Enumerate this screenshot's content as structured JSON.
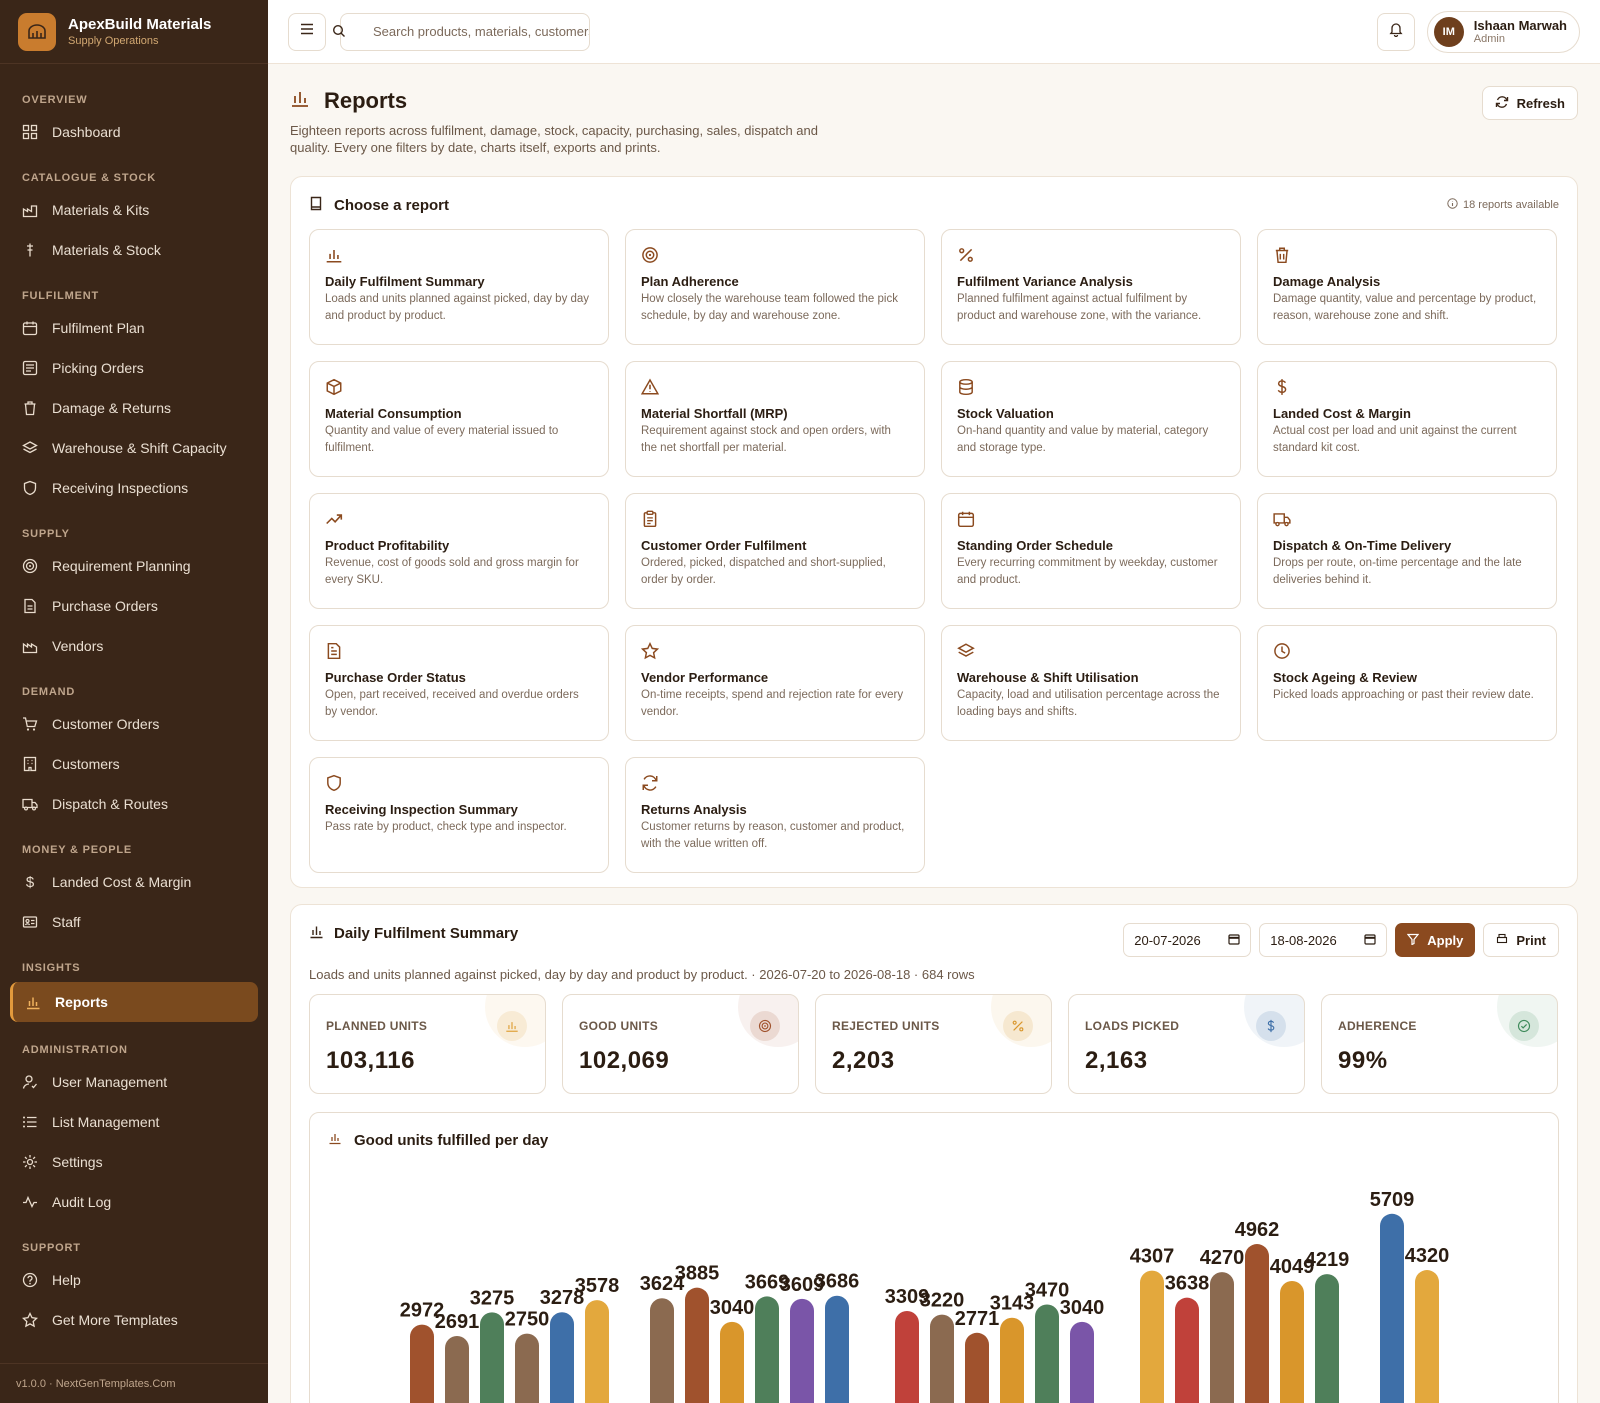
{
  "brand": {
    "name": "ApexBuild Materials",
    "subtitle": "Supply Operations"
  },
  "sidebar": {
    "sections": {
      "overview": "OVERVIEW",
      "catalogue": "CATALOGUE & STOCK",
      "fulfilment": "FULFILMENT",
      "supply": "SUPPLY",
      "demand": "DEMAND",
      "money": "MONEY & PEOPLE",
      "insights": "INSIGHTS",
      "administration": "ADMINISTRATION",
      "support": "SUPPORT"
    },
    "items": {
      "dashboard": "Dashboard",
      "materials_kits": "Materials & Kits",
      "materials_stock": "Materials & Stock",
      "fulfilment_plan": "Fulfilment Plan",
      "picking_orders": "Picking Orders",
      "damage_returns": "Damage & Returns",
      "warehouse_capacity": "Warehouse & Shift Capacity",
      "receiving_inspections": "Receiving Inspections",
      "requirement_planning": "Requirement Planning",
      "purchase_orders": "Purchase Orders",
      "vendors": "Vendors",
      "customer_orders": "Customer Orders",
      "customers": "Customers",
      "dispatch_routes": "Dispatch & Routes",
      "landed_cost": "Landed Cost & Margin",
      "staff": "Staff",
      "reports": "Reports",
      "user_management": "User Management",
      "list_management": "List Management",
      "settings": "Settings",
      "audit_log": "Audit Log",
      "help": "Help",
      "get_templates": "Get More Templates"
    },
    "footer": "v1.0.0 · NextGenTemplates.Com"
  },
  "topbar": {
    "search_placeholder": "Search products, materials, customers",
    "user_initials": "IM",
    "user_name": "Ishaan Marwah",
    "user_role": "Admin"
  },
  "page": {
    "title": "Reports",
    "description": "Eighteen reports across fulfilment, damage, stock, capacity, purchasing, sales, dispatch and quality. Every one filters by date, charts itself, exports and prints.",
    "refresh_label": "Refresh"
  },
  "chooser": {
    "title": "Choose a report",
    "available": "18 reports available",
    "reports": [
      {
        "icon": "bar-chart-icon",
        "title": "Daily Fulfilment Summary",
        "desc": "Loads and units planned against picked, day by day and product by product."
      },
      {
        "icon": "target-icon",
        "title": "Plan Adherence",
        "desc": "How closely the warehouse team followed the pick schedule, by day and warehouse zone."
      },
      {
        "icon": "percent-icon",
        "title": "Fulfilment Variance Analysis",
        "desc": "Planned fulfilment against actual fulfilment by product and warehouse zone, with the variance."
      },
      {
        "icon": "trash-icon",
        "title": "Damage Analysis",
        "desc": "Damage quantity, value and percentage by product, reason, warehouse zone and shift."
      },
      {
        "icon": "box-icon",
        "title": "Material Consumption",
        "desc": "Quantity and value of every material issued to fulfilment."
      },
      {
        "icon": "warning-icon",
        "title": "Material Shortfall (MRP)",
        "desc": "Requirement against stock and open orders, with the net shortfall per material."
      },
      {
        "icon": "database-icon",
        "title": "Stock Valuation",
        "desc": "On-hand quantity and value by material, category and storage type."
      },
      {
        "icon": "dollar-icon",
        "title": "Landed Cost & Margin",
        "desc": "Actual cost per load and unit against the current standard kit cost."
      },
      {
        "icon": "trend-icon",
        "title": "Product Profitability",
        "desc": "Revenue, cost of goods sold and gross margin for every SKU."
      },
      {
        "icon": "clipboard-icon",
        "title": "Customer Order Fulfilment",
        "desc": "Ordered, picked, dispatched and short-supplied, order by order."
      },
      {
        "icon": "calendar-icon",
        "title": "Standing Order Schedule",
        "desc": "Every recurring commitment by weekday, customer and product."
      },
      {
        "icon": "truck-icon",
        "title": "Dispatch & On-Time Delivery",
        "desc": "Drops per route, on-time percentage and the late deliveries behind it."
      },
      {
        "icon": "document-icon",
        "title": "Purchase Order Status",
        "desc": "Open, part received, received and overdue orders by vendor."
      },
      {
        "icon": "star-icon",
        "title": "Vendor Performance",
        "desc": "On-time receipts, spend and rejection rate for every vendor."
      },
      {
        "icon": "layers-icon",
        "title": "Warehouse & Shift Utilisation",
        "desc": "Capacity, load and utilisation percentage across the loading bays and shifts."
      },
      {
        "icon": "clock-icon",
        "title": "Stock Ageing & Review",
        "desc": "Picked loads approaching or past their review date."
      },
      {
        "icon": "shield-icon",
        "title": "Receiving Inspection Summary",
        "desc": "Pass rate by product, check type and inspector."
      },
      {
        "icon": "refresh-icon",
        "title": "Returns Analysis",
        "desc": "Customer returns by reason, customer and product, with the value written off."
      }
    ]
  },
  "summary": {
    "title": "Daily Fulfilment Summary",
    "date_from": "20-07-2026",
    "date_to": "18-08-2026",
    "apply_label": "Apply",
    "print_label": "Print",
    "meta": "Loads and units planned against picked, day by day and product by product.  ·  2026-07-20 to 2026-08-18  ·  684 rows",
    "kpis": [
      {
        "label": "PLANNED UNITS",
        "value": "103,116",
        "color": "#e0a33d",
        "icon": "bar-chart-icon"
      },
      {
        "label": "GOOD UNITS",
        "value": "102,069",
        "color": "#a0522d",
        "icon": "target-icon"
      },
      {
        "label": "REJECTED UNITS",
        "value": "2,203",
        "color": "#d9962b",
        "icon": "percent-icon"
      },
      {
        "label": "LOADS PICKED",
        "value": "2,163",
        "color": "#3e6fa8",
        "icon": "dollar-icon"
      },
      {
        "label": "ADHERENCE",
        "value": "99%",
        "color": "#3e8a5a",
        "icon": "check-circle-icon"
      }
    ]
  },
  "chart_data": {
    "type": "bar",
    "title": "Good units fulfilled per day",
    "ylim": [
      0,
      6000
    ],
    "groups": [
      {
        "values": [
          2972,
          2691,
          3275,
          2750,
          3278,
          3578
        ],
        "colors": [
          "#a0522d",
          "#8b6a50",
          "#4f7f5a",
          "#8b6a50",
          "#3e6fa8",
          "#e3a83d"
        ]
      },
      {
        "values": [
          3624,
          3885,
          3040,
          3669,
          3609,
          3686
        ],
        "colors": [
          "#8b6a50",
          "#a0522d",
          "#d9962b",
          "#4f7f5a",
          "#7a55a8",
          "#3e6fa8"
        ]
      },
      {
        "values": [
          3309,
          3220,
          2771,
          3143,
          3470,
          3040
        ],
        "colors": [
          "#c0413a",
          "#8b6a50",
          "#a0522d",
          "#d9962b",
          "#4f7f5a",
          "#7a55a8"
        ]
      },
      {
        "values": [
          4307,
          3638,
          4270,
          4962,
          4049,
          4219
        ],
        "colors": [
          "#e3a83d",
          "#c0413a",
          "#8b6a50",
          "#a0522d",
          "#d9962b",
          "#4f7f5a"
        ]
      },
      {
        "values": [
          5709,
          4320
        ],
        "colors": [
          "#3e6fa8",
          "#e3a83d"
        ]
      }
    ]
  }
}
